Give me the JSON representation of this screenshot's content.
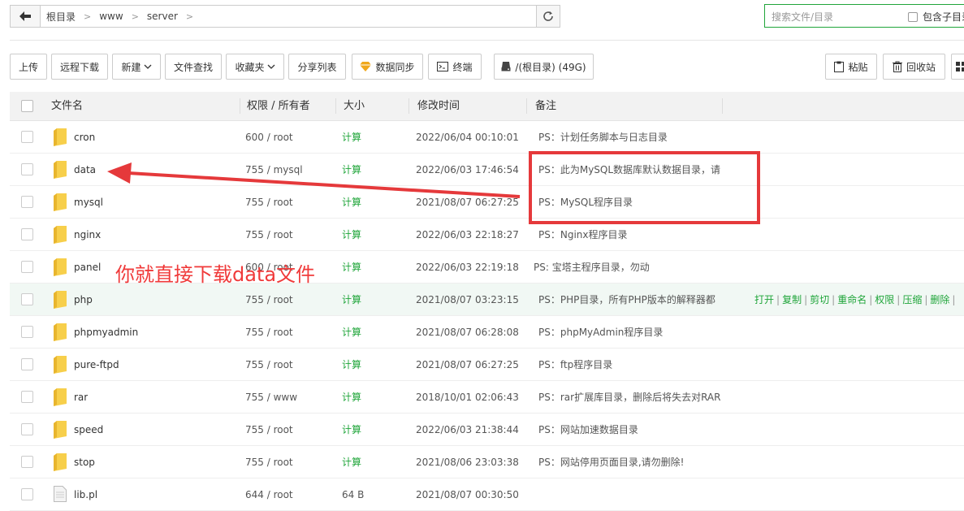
{
  "path": {
    "crumbs": [
      "根目录",
      "www",
      "server"
    ]
  },
  "search": {
    "placeholder": "搜索文件/目录",
    "subdir_label": "包含子目录"
  },
  "toolbar": {
    "upload": "上传",
    "remote_download": "远程下载",
    "new": "新建",
    "file_search": "文件查找",
    "favorites": "收藏夹",
    "share_list": "分享列表",
    "data_sync": "数据同步",
    "terminal": "终端",
    "disk": "/(根目录) (49G)",
    "paste": "粘贴",
    "recycle": "回收站"
  },
  "columns": {
    "name": "文件名",
    "perm": "权限 / 所有者",
    "size": "大小",
    "mtime": "修改时间",
    "note": "备注"
  },
  "rows": [
    {
      "type": "folder",
      "name": "cron",
      "perm": "600 / root",
      "size": "计算",
      "mtime": "2022/06/04 00:10:01",
      "note": "PS：计划任务脚本与日志目录"
    },
    {
      "type": "folder",
      "name": "data",
      "perm": "755 / mysql",
      "size": "计算",
      "mtime": "2022/06/03 17:46:54",
      "note": "PS：此为MySQL数据库默认数据目录，请"
    },
    {
      "type": "folder",
      "name": "mysql",
      "perm": "755 / root",
      "size": "计算",
      "mtime": "2021/08/07 06:27:25",
      "note": "PS：MySQL程序目录"
    },
    {
      "type": "folder",
      "name": "nginx",
      "perm": "755 / root",
      "size": "计算",
      "mtime": "2022/06/03 22:18:27",
      "note": "PS：Nginx程序目录"
    },
    {
      "type": "folder",
      "name": "panel",
      "perm": "600 / root",
      "size": "计算",
      "mtime": "2022/06/03 22:19:18",
      "note": "PS: 宝塔主程序目录，勿动"
    },
    {
      "type": "folder",
      "name": "php",
      "perm": "755 / root",
      "size": "计算",
      "mtime": "2021/08/07 03:23:15",
      "note": "PS：PHP目录，所有PHP版本的解释器都"
    },
    {
      "type": "folder",
      "name": "phpmyadmin",
      "perm": "755 / root",
      "size": "计算",
      "mtime": "2021/08/07 06:28:08",
      "note": "PS：phpMyAdmin程序目录"
    },
    {
      "type": "folder",
      "name": "pure-ftpd",
      "perm": "755 / root",
      "size": "计算",
      "mtime": "2021/08/07 06:27:25",
      "note": "PS：ftp程序目录"
    },
    {
      "type": "folder",
      "name": "rar",
      "perm": "755 / www",
      "size": "计算",
      "mtime": "2018/10/01 02:06:43",
      "note": "PS：rar扩展库目录，删除后将失去对RAR"
    },
    {
      "type": "folder",
      "name": "speed",
      "perm": "755 / root",
      "size": "计算",
      "mtime": "2022/06/03 21:38:44",
      "note": "PS：网站加速数据目录"
    },
    {
      "type": "folder",
      "name": "stop",
      "perm": "755 / root",
      "size": "计算",
      "mtime": "2021/08/06 23:03:38",
      "note": "PS：网站停用页面目录,请勿删除!"
    },
    {
      "type": "file",
      "name": "lib.pl",
      "perm": "644 / root",
      "size": "64 B",
      "mtime": "2021/08/07 00:30:50",
      "note": ""
    }
  ],
  "row_ops": [
    "打开",
    "复制",
    "剪切",
    "重命名",
    "权限",
    "压缩",
    "删除"
  ],
  "annotation": {
    "text": "你就直接下载data文件",
    "color": "#e5393b"
  },
  "colors": {
    "accent": "#20a53a",
    "folder": "#f7cf4b"
  }
}
